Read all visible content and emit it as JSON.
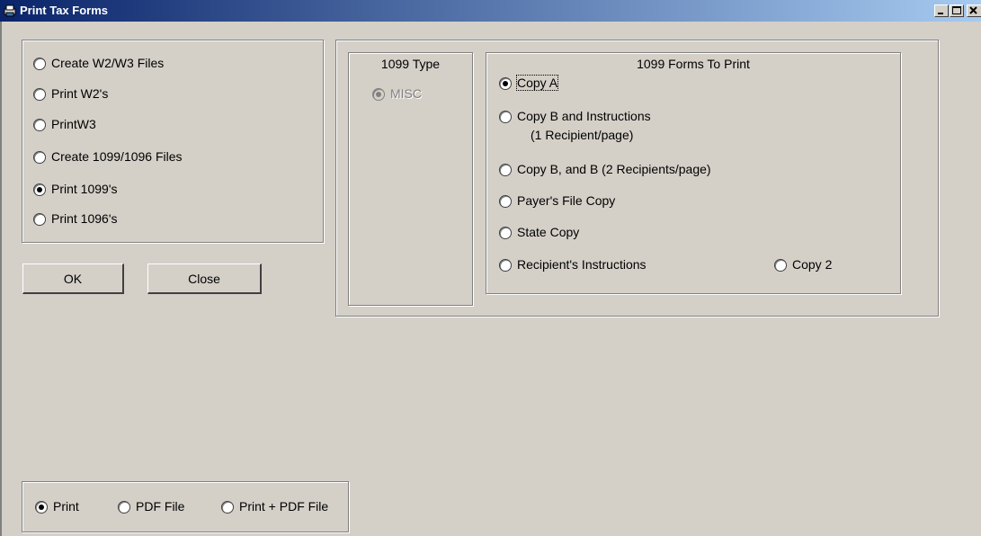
{
  "window": {
    "title": "Print Tax Forms",
    "icon": "printer-app-icon",
    "controls": [
      "minimize-icon",
      "maximize-icon",
      "close-icon"
    ]
  },
  "tax_options": [
    {
      "label": "Create W2/W3 Files",
      "checked": false
    },
    {
      "label": "Print W2's",
      "checked": false
    },
    {
      "label": "PrintW3",
      "checked": false
    },
    {
      "label": "Create 1099/1096 Files",
      "checked": false
    },
    {
      "label": "Print 1099's",
      "checked": true
    },
    {
      "label": "Print 1096's",
      "checked": false
    }
  ],
  "buttons": {
    "ok": "OK",
    "close": "Close"
  },
  "type_group": {
    "title": "1099 Type",
    "option": {
      "label": "MISC",
      "checked": true,
      "enabled": false
    }
  },
  "forms_group": {
    "title": "1099 Forms To Print",
    "options": [
      {
        "label": "Copy A",
        "checked": true
      },
      {
        "label": "Copy B  and Instructions",
        "sublabel": "(1 Recipient/page)",
        "checked": false
      },
      {
        "label": "Copy B, and B  (2 Recipients/page)",
        "checked": false
      },
      {
        "label": "Payer's File Copy",
        "checked": false
      },
      {
        "label": "State Copy",
        "checked": false
      },
      {
        "label": "Recipient's Instructions",
        "checked": false
      },
      {
        "label": "Copy 2",
        "checked": false
      }
    ]
  },
  "output_options": [
    {
      "label": "Print",
      "checked": true
    },
    {
      "label": "PDF File",
      "checked": false
    },
    {
      "label": "Print + PDF File",
      "checked": false
    }
  ],
  "colors": {
    "face": "#d4d0c8",
    "title_start": "#0a246a",
    "title_end": "#a6caf0"
  }
}
